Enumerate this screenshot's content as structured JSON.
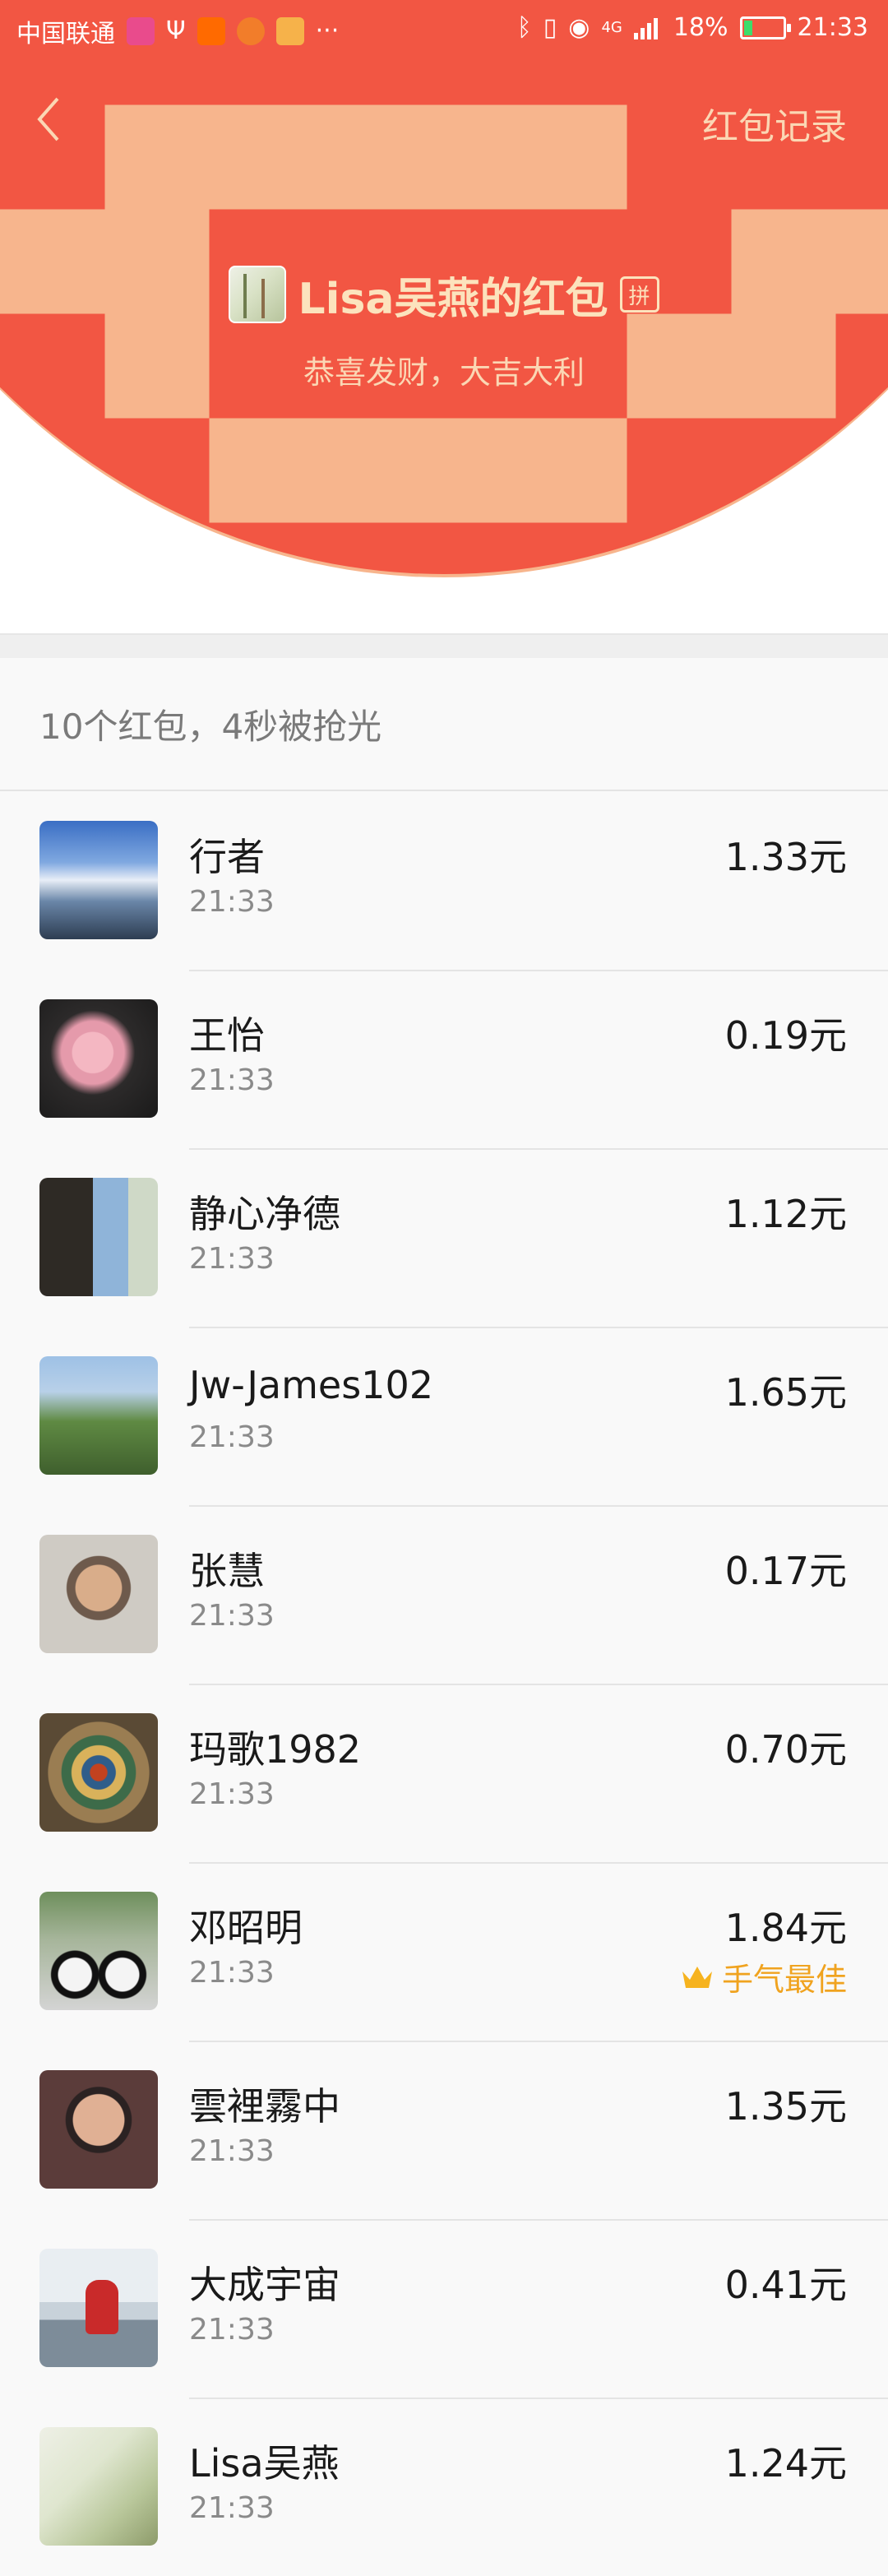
{
  "status_bar": {
    "carrier": "中国联通",
    "network": "4G",
    "battery": "18%",
    "time": "21:33"
  },
  "nav": {
    "record_label": "红包记录"
  },
  "packet": {
    "sender_name": "Lisa吴燕的红包",
    "type_badge": "拼",
    "wish": "恭喜发财，大吉大利"
  },
  "summary": "10个红包，4秒被抢光",
  "receivers": [
    {
      "name": "行者",
      "time": "21:33",
      "amount": "1.33元"
    },
    {
      "name": "王怡",
      "time": "21:33",
      "amount": "0.19元"
    },
    {
      "name": "静心净德",
      "time": "21:33",
      "amount": "1.12元"
    },
    {
      "name": "Jw-James102",
      "time": "21:33",
      "amount": "1.65元"
    },
    {
      "name": "张慧",
      "time": "21:33",
      "amount": "0.17元"
    },
    {
      "name": "玛歌1982",
      "time": "21:33",
      "amount": "0.70元"
    },
    {
      "name": "邓昭明",
      "time": "21:33",
      "amount": "1.84元",
      "best": "手气最佳"
    },
    {
      "name": "雲裡霧中",
      "time": "21:33",
      "amount": "1.35元"
    },
    {
      "name": "大成宇宙",
      "time": "21:33",
      "amount": "0.41元"
    },
    {
      "name": "Lisa吴燕",
      "time": "21:33",
      "amount": "1.24元"
    }
  ],
  "colors": {
    "header_red": "#f25643",
    "gold_text": "#fbd7b4",
    "best_luck": "#f0a31f"
  },
  "icons": {
    "back": "chevron-left-icon",
    "crown": "crown-icon"
  }
}
